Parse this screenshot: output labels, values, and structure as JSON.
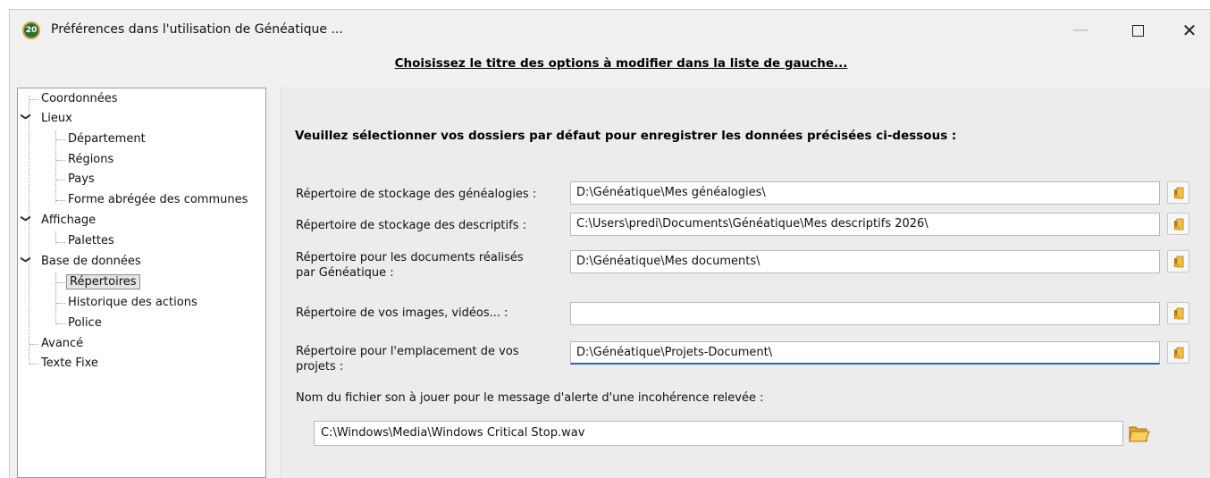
{
  "window": {
    "title": "Préférences dans l'utilisation de Généatique ...",
    "app_icon_text": "20",
    "controls": {
      "minimize": "—",
      "close": "✕"
    }
  },
  "subtitle": "Choisissez le titre des options à modifier dans la liste de gauche...",
  "tree": {
    "items": [
      {
        "label": "Coordonnées"
      },
      {
        "label": "Lieux",
        "expanded": true
      },
      {
        "label": "Département"
      },
      {
        "label": "Régions"
      },
      {
        "label": "Pays"
      },
      {
        "label": "Forme abrégée des communes"
      },
      {
        "label": "Affichage",
        "expanded": true
      },
      {
        "label": "Palettes"
      },
      {
        "label": "Base de données",
        "expanded": true
      },
      {
        "label": "Répertoires",
        "selected": true
      },
      {
        "label": "Historique des actions"
      },
      {
        "label": "Police"
      },
      {
        "label": "Avancé"
      },
      {
        "label": "Texte Fixe"
      }
    ]
  },
  "main": {
    "heading": "Veuillez sélectionner vos dossiers par défaut pour enregistrer les données précisées ci-dessous :",
    "rows": [
      {
        "label": "Répertoire de stockage des généalogies :",
        "value": "D:\\Généatique\\Mes généalogies\\"
      },
      {
        "label": "Répertoire de stockage des descriptifs :",
        "value": "C:\\Users\\predi\\Documents\\Généatique\\Mes descriptifs 2026\\"
      },
      {
        "label": "Répertoire pour les documents réalisés par Généatique :",
        "value": "D:\\Généatique\\Mes documents\\"
      },
      {
        "label": "Répertoire de vos images, vidéos... :",
        "value": ""
      },
      {
        "label": "Répertoire pour l'emplacement de vos projets :",
        "value": "D:\\Généatique\\Projets-Document\\"
      }
    ],
    "sound_label": "Nom du fichier son à jouer pour le message d'alerte d'une incohérence relevée :",
    "sound_value": "C:\\Windows\\Media\\Windows Critical Stop.wav"
  },
  "colors": {
    "accent": "#2a64b4",
    "folder": "#e9b43a"
  },
  "icons": {
    "browse": "folder-browse-icon",
    "open": "open-folder-icon"
  }
}
